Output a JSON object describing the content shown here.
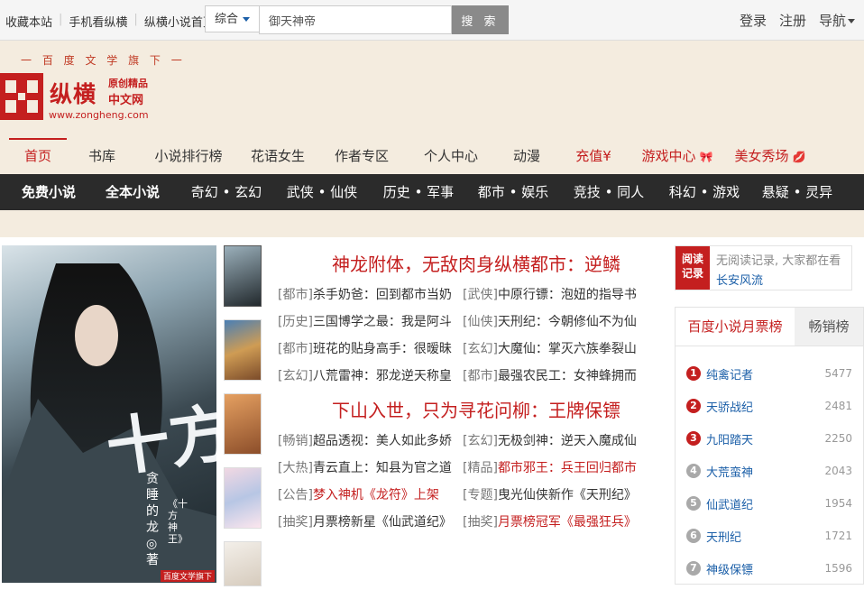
{
  "topbar": {
    "links": [
      "收藏本站",
      "手机看纵横",
      "纵横小说首页"
    ],
    "search": {
      "category": "综合",
      "value": "御天神帝",
      "button": "搜 索"
    },
    "right": {
      "login": "登录",
      "register": "注册",
      "nav": "导航"
    }
  },
  "header": {
    "slogan": "一 百 度 文 学 旗 下 一",
    "logo_name": "纵横",
    "logo_sub1": "原创精品",
    "logo_sub2": "中文网",
    "logo_url": "www.zongheng.com"
  },
  "mainnav": [
    {
      "label": "首页",
      "active": true
    },
    {
      "label": "书库"
    },
    {
      "label": "小说排行榜"
    },
    {
      "label": "花语女生"
    },
    {
      "label": "作者专区"
    },
    {
      "label": "个人中心"
    },
    {
      "label": "动漫"
    },
    {
      "label": "充值¥",
      "red": true
    },
    {
      "label": "游戏中心",
      "red": true
    },
    {
      "label": "美女秀场",
      "red": true
    }
  ],
  "catbar": [
    "免费小说",
    "全本小说",
    "奇幻 • 玄幻",
    "武侠 • 仙侠",
    "历史 • 军事",
    "都市 • 娱乐",
    "竞技 • 同人",
    "科幻 • 游戏",
    "悬疑 • 灵异"
  ],
  "cover": {
    "title": "十方神王",
    "author": "贪睡的龙◎著",
    "book": "《十方神王》",
    "publisher": "百度文学旗下"
  },
  "center": {
    "headline1": "神龙附体，无敌肉身纵横都市：逆鳞",
    "rows1": [
      [
        {
          "tag": "[都市]",
          "text": "杀手奶爸：回到都市当奶"
        },
        {
          "tag": "[武侠]",
          "text": "中原行镖：泡妞的指导书"
        }
      ],
      [
        {
          "tag": "[历史]",
          "text": "三国博学之最：我是阿斗"
        },
        {
          "tag": "[仙侠]",
          "text": "天刑纪：今朝修仙不为仙"
        }
      ],
      [
        {
          "tag": "[都市]",
          "text": "班花的贴身高手：很暧昧"
        },
        {
          "tag": "[玄幻]",
          "text": "大魔仙：掌灭六族拳裂山"
        }
      ],
      [
        {
          "tag": "[玄幻]",
          "text": "八荒雷神：邪龙逆天称皇"
        },
        {
          "tag": "[都市]",
          "text": "最强农民工：女神蜂拥而"
        }
      ]
    ],
    "headline2": "下山入世，只为寻花问柳：王牌保镖",
    "rows2": [
      [
        {
          "tag": "[畅销]",
          "text": "超品透视：美人如此多娇"
        },
        {
          "tag": "[玄幻]",
          "text": "无极剑神：逆天入魔成仙"
        }
      ],
      [
        {
          "tag": "[大热]",
          "text": "青云直上：知县为官之道"
        },
        {
          "tag": "[精品]",
          "text": "都市邪王：兵王回归都市",
          "red": true
        }
      ],
      [
        {
          "tag": "[公告]",
          "text": "梦入神机《龙符》上架",
          "red": true
        },
        {
          "tag": "[专题]",
          "text": "曳光仙侠新作《天刑纪》"
        }
      ],
      [
        {
          "tag": "[抽奖]",
          "text": "月票榜新星《仙武道纪》"
        },
        {
          "tag": "[抽奖]",
          "text": "月票榜冠军《最强狂兵》",
          "red": true
        }
      ]
    ]
  },
  "readbox": {
    "label": "阅读记录",
    "text1": "无阅读记录, 大家都在看",
    "text2": "长安风流"
  },
  "rank": {
    "tabs": [
      "百度小说月票榜",
      "畅销榜"
    ],
    "items": [
      {
        "num": "1",
        "name": "纯禽记者",
        "count": "5477"
      },
      {
        "num": "2",
        "name": "天骄战纪",
        "count": "2481"
      },
      {
        "num": "3",
        "name": "九阳踏天",
        "count": "2250"
      },
      {
        "num": "4",
        "name": "大荒蛮神",
        "count": "2043"
      },
      {
        "num": "5",
        "name": "仙武道纪",
        "count": "1954"
      },
      {
        "num": "6",
        "name": "天刑纪",
        "count": "1721"
      },
      {
        "num": "7",
        "name": "神级保镖",
        "count": "1596"
      }
    ]
  },
  "colors": {
    "brand_red": "#c41f1f",
    "link_blue": "#1b5fa8",
    "catbar_bg": "#2b2b2b",
    "header_bg": "#f4ecdf"
  }
}
